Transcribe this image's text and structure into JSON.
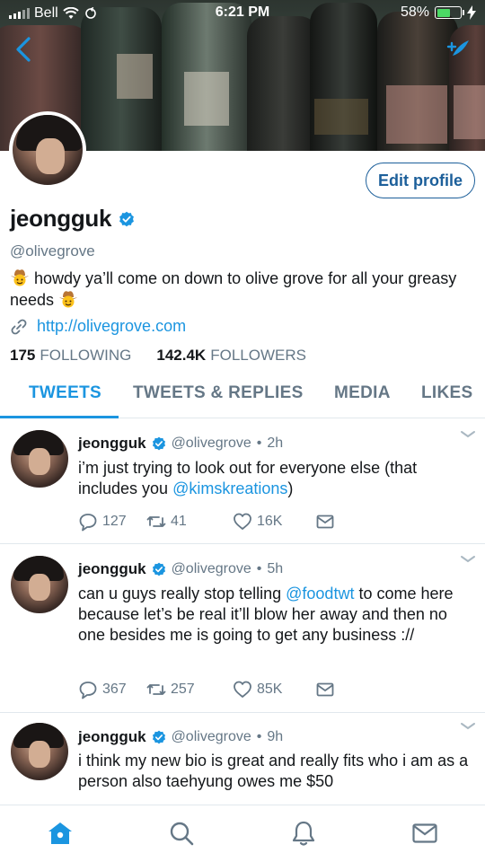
{
  "status_bar": {
    "carrier": "Bell",
    "time": "6:21 PM",
    "battery": "58%",
    "battery_level": 0.58
  },
  "profile": {
    "edit_button": "Edit profile",
    "name": "jeongguk",
    "handle": "@olivegrove",
    "bio_part1": "howdy ya’ll come on down to olive grove for all your greasy needs",
    "link": "http://olivegrove.com",
    "following_count": "175",
    "following_label": "FOLLOWING",
    "followers_count": "142.4K",
    "followers_label": "FOLLOWERS"
  },
  "tabs": [
    {
      "label": "TWEETS"
    },
    {
      "label": "TWEETS & REPLIES"
    },
    {
      "label": "MEDIA"
    },
    {
      "label": "LIKES"
    }
  ],
  "tweets": [
    {
      "name": "jeongguk",
      "handle": "@olivegrove",
      "time": "2h",
      "text_pre": "i’m just trying to look out for everyone else (that includes you ",
      "mention": "@kimskreations",
      "text_post": ")",
      "replies": "127",
      "retweets": "41",
      "likes": "16K"
    },
    {
      "name": "jeongguk",
      "handle": "@olivegrove",
      "time": "5h",
      "text_pre": "can u guys really stop telling ",
      "mention": "@foodtwt",
      "text_post": " to come here because let’s be real it’ll blow her away and then no one besides me is going to get any business ://",
      "replies": "367",
      "retweets": "257",
      "likes": "85K"
    },
    {
      "name": "jeongguk",
      "handle": "@olivegrove",
      "time": "9h",
      "text_pre": "i think my new bio is great and really fits who i am as a person also taehyung owes me $50",
      "mention": "",
      "text_post": ""
    }
  ],
  "icons": {
    "back": "back-chevron-icon",
    "compose": "compose-icon",
    "verified": "verified-badge-icon",
    "link": "link-icon",
    "emoji": "cowboy-emoji-icon",
    "reply": "reply-icon",
    "retweet": "retweet-icon",
    "like": "heart-icon",
    "dm": "message-icon",
    "nav": [
      "home-icon",
      "search-icon",
      "notifications-icon",
      "messages-icon"
    ]
  },
  "colors": {
    "accent": "#1b95e0",
    "edit_border": "#1c5f9a",
    "secondary_text": "#657786",
    "battery": "#4cd964"
  }
}
